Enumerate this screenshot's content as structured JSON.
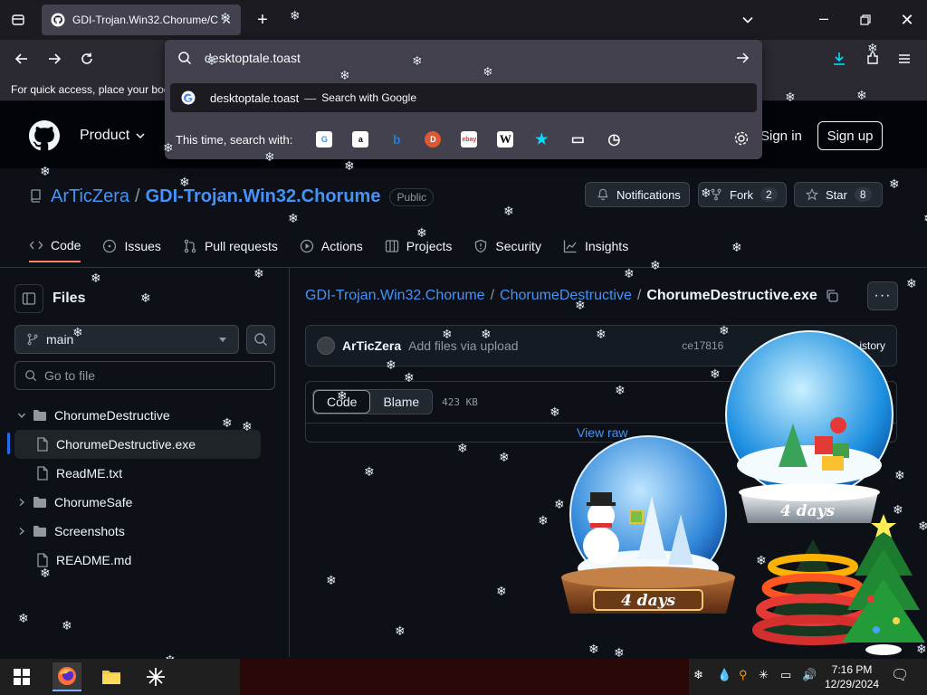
{
  "browser": {
    "tab_title": "GDI-Trojan.Win32.Chorume/C",
    "new_tab": "+",
    "tab_close": "✕",
    "bookmarks_hint": "For quick access, place your boo",
    "url_value": "desktoptale.toast",
    "suggestion_query": "desktoptale.toast",
    "suggestion_sep": "—",
    "suggestion_action": "Search with Google",
    "search_with_label": "This time, search with:",
    "engines": [
      {
        "name": "google-engine",
        "label": "G",
        "color": "#4285f4"
      },
      {
        "name": "amazon-engine",
        "label": "a",
        "color": "#ff9900"
      },
      {
        "name": "bing-engine",
        "label": "b",
        "color": "#2b7cd3"
      },
      {
        "name": "duckduckgo-engine",
        "label": "D",
        "color": "#de5833"
      },
      {
        "name": "ebay-engine",
        "label": "ebay",
        "color": "#e53238"
      },
      {
        "name": "wikipedia-engine",
        "label": "W",
        "color": "#ffffff"
      },
      {
        "name": "bookmarks-engine",
        "label": "★",
        "color": "#00ddff"
      },
      {
        "name": "tabs-engine",
        "label": "▭",
        "color": "#fbfbfe"
      },
      {
        "name": "history-engine",
        "label": "◷",
        "color": "#fbfbfe"
      }
    ]
  },
  "github": {
    "product": "Product",
    "signin": "Sign in",
    "signup": "Sign up"
  },
  "repo": {
    "owner": "ArTicZera",
    "slash": "/",
    "name": "GDI-Trojan.Win32.Chorume",
    "visibility": "Public",
    "notifications": "Notifications",
    "fork_label": "Fork",
    "fork_count": "2",
    "star_label": "Star",
    "star_count": "8",
    "tabs": [
      {
        "label": "Code",
        "icon": "code-icon",
        "active": true
      },
      {
        "label": "Issues",
        "icon": "issues-icon"
      },
      {
        "label": "Pull requests",
        "icon": "pull-request-icon"
      },
      {
        "label": "Actions",
        "icon": "actions-icon"
      },
      {
        "label": "Projects",
        "icon": "projects-icon"
      },
      {
        "label": "Security",
        "icon": "shield-icon"
      },
      {
        "label": "Insights",
        "icon": "graph-icon"
      }
    ]
  },
  "sidebar": {
    "title": "Files",
    "branch": "main",
    "goto_placeholder": "Go to file",
    "tree": [
      {
        "label": "ChorumeDestructive",
        "type": "folder",
        "expanded": true,
        "depth": 0
      },
      {
        "label": "ChorumeDestructive.exe",
        "type": "file",
        "depth": 1,
        "selected": true
      },
      {
        "label": "ReadME.txt",
        "type": "file",
        "depth": 1
      },
      {
        "label": "ChorumeSafe",
        "type": "folder",
        "expanded": false,
        "depth": 0
      },
      {
        "label": "Screenshots",
        "type": "folder",
        "expanded": false,
        "depth": 0
      },
      {
        "label": "README.md",
        "type": "file",
        "depth": 0
      }
    ]
  },
  "main": {
    "crumb_repo": "GDI-Trojan.Win32.Chorume",
    "crumb_sep": "/",
    "crumb_folder": "ChorumeDestructive",
    "crumb_file": "ChorumeDestructive.exe",
    "more": "···",
    "commit_author": "ArTicZera",
    "commit_message": "Add files via upload",
    "commit_sha": "ce17816",
    "history": "istory",
    "seg_code": "Code",
    "seg_blame": "Blame",
    "file_size": "423 KB",
    "view_raw": "View raw"
  },
  "overlay": {
    "globe_label_1": "4 days",
    "globe_label_2": "4 days"
  },
  "taskbar": {
    "time": "7:16 PM",
    "date": "12/29/2024"
  }
}
